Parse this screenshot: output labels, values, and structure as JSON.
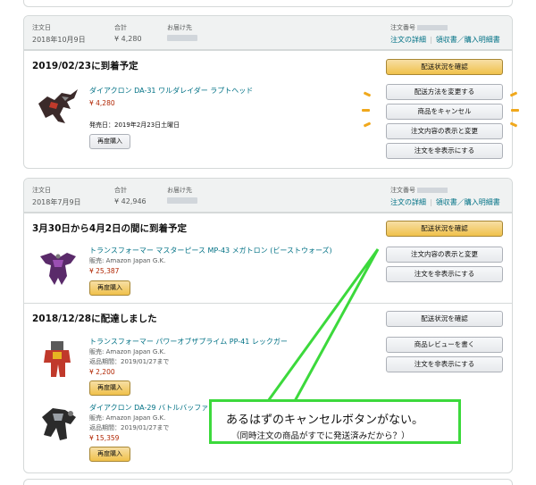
{
  "order1": {
    "date_label": "注文日",
    "date": "2018年10月9日",
    "total_label": "合計",
    "total": "¥ 4,280",
    "ship_to_label": "お届け先",
    "order_no_label": "注文番号",
    "link_details": "注文の詳細",
    "link_receipt": "領収書／購入明細書",
    "status": "2019/02/23に到着予定",
    "product": {
      "title": "ダイアクロン DA-31 ワルダレイダー ラプトヘッド",
      "price": "¥ 4,280",
      "release": "発売日：2019年2月23日土曜日",
      "rebuy": "再度購入"
    },
    "buttons": [
      "配送状況を確認",
      "配送方法を変更する",
      "商品をキャンセル",
      "注文内容の表示と変更",
      "注文を非表示にする"
    ]
  },
  "order2": {
    "date_label": "注文日",
    "date": "2018年7月9日",
    "total_label": "合計",
    "total": "¥ 42,946",
    "ship_to_label": "お届け先",
    "order_no_label": "注文番号",
    "link_details": "注文の詳細",
    "link_receipt": "領収書／購入明細書",
    "shipment1": {
      "status": "3月30日から4月2日の間に到着予定",
      "product": {
        "title": "トランスフォーマー マスターピース MP-43 メガトロン (ビーストウォーズ)",
        "seller": "販売: Amazon Japan G.K.",
        "price": "¥ 25,387",
        "rebuy": "再度購入"
      },
      "buttons": [
        "配送状況を確認",
        "注文内容の表示と変更",
        "注文を非表示にする"
      ]
    },
    "shipment2": {
      "status": "2018/12/28に配達しました",
      "product1": {
        "title": "トランスフォーマー パワーオブザプライム PP-41 レックガー",
        "seller": "販売: Amazon Japan G.K.",
        "return": "返品期間：2019/01/27まで",
        "price": "¥ 2,200",
        "rebuy": "再度購入"
      },
      "product2": {
        "title": "ダイアクロン DA-29 バトルバッファロー",
        "seller": "販売: Amazon Japan G.K.",
        "return": "返品期間：2019/01/27まで",
        "price": "¥ 15,359",
        "rebuy": "再度購入"
      },
      "buttons": [
        "配送状況を確認",
        "商品レビューを書く",
        "注文を非表示にする"
      ]
    }
  },
  "callout": {
    "main": "あるはずのキャンセルボタンがない。",
    "sub": "（同時注文の商品がすでに発送済みだから？）"
  },
  "colors": {
    "callout_border": "#3cd93c",
    "highlight_dash": "#f0a81c",
    "link": "#007185",
    "price": "#b12704"
  }
}
